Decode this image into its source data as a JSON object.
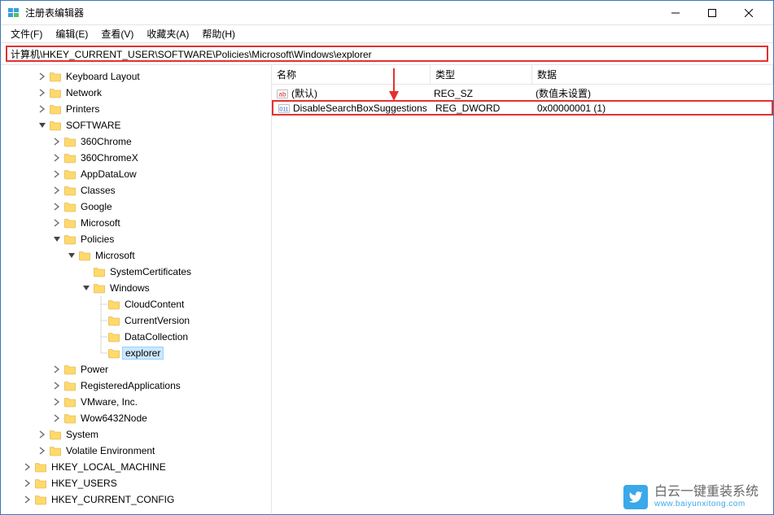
{
  "window": {
    "title": "注册表编辑器"
  },
  "menu": {
    "file": "文件(F)",
    "edit": "编辑(E)",
    "view": "查看(V)",
    "favorites": "收藏夹(A)",
    "help": "帮助(H)"
  },
  "address": {
    "value": "计算机\\HKEY_CURRENT_USER\\SOFTWARE\\Policies\\Microsoft\\Windows\\explorer"
  },
  "tree": [
    {
      "depth": 2,
      "exp": ">",
      "label": "Keyboard Layout"
    },
    {
      "depth": 2,
      "exp": ">",
      "label": "Network"
    },
    {
      "depth": 2,
      "exp": ">",
      "label": "Printers"
    },
    {
      "depth": 2,
      "exp": "v",
      "label": "SOFTWARE"
    },
    {
      "depth": 3,
      "exp": ">",
      "label": "360Chrome"
    },
    {
      "depth": 3,
      "exp": ">",
      "label": "360ChromeX"
    },
    {
      "depth": 3,
      "exp": ">",
      "label": "AppDataLow"
    },
    {
      "depth": 3,
      "exp": ">",
      "label": "Classes"
    },
    {
      "depth": 3,
      "exp": ">",
      "label": "Google"
    },
    {
      "depth": 3,
      "exp": ">",
      "label": "Microsoft"
    },
    {
      "depth": 3,
      "exp": "v",
      "label": "Policies"
    },
    {
      "depth": 4,
      "exp": "v",
      "label": "Microsoft"
    },
    {
      "depth": 5,
      "exp": "",
      "label": "SystemCertificates"
    },
    {
      "depth": 5,
      "exp": "v",
      "label": "Windows"
    },
    {
      "depth": 6,
      "exp": "",
      "label": "CloudContent",
      "dotline": true
    },
    {
      "depth": 6,
      "exp": "",
      "label": "CurrentVersion",
      "dotline": true
    },
    {
      "depth": 6,
      "exp": "",
      "label": "DataCollection",
      "dotline": true
    },
    {
      "depth": 6,
      "exp": "",
      "label": "explorer",
      "dotline": true,
      "selected": true
    },
    {
      "depth": 3,
      "exp": ">",
      "label": "Power"
    },
    {
      "depth": 3,
      "exp": ">",
      "label": "RegisteredApplications"
    },
    {
      "depth": 3,
      "exp": ">",
      "label": "VMware, Inc."
    },
    {
      "depth": 3,
      "exp": ">",
      "label": "Wow6432Node"
    },
    {
      "depth": 2,
      "exp": ">",
      "label": "System"
    },
    {
      "depth": 2,
      "exp": ">",
      "label": "Volatile Environment"
    },
    {
      "depth": 1,
      "exp": ">",
      "label": "HKEY_LOCAL_MACHINE"
    },
    {
      "depth": 1,
      "exp": ">",
      "label": "HKEY_USERS"
    },
    {
      "depth": 1,
      "exp": ">",
      "label": "HKEY_CURRENT_CONFIG"
    }
  ],
  "list": {
    "headers": {
      "name": "名称",
      "type": "类型",
      "data": "数据"
    },
    "rows": [
      {
        "icon": "string",
        "name": "(默认)",
        "type": "REG_SZ",
        "data": "(数值未设置)",
        "highlight": false
      },
      {
        "icon": "binary",
        "name": "DisableSearchBoxSuggestions",
        "type": "REG_DWORD",
        "data": "0x00000001 (1)",
        "highlight": true
      }
    ]
  },
  "watermark": {
    "line1": "白云一键重装系统",
    "line2": "www.baiyunxitong.com"
  }
}
